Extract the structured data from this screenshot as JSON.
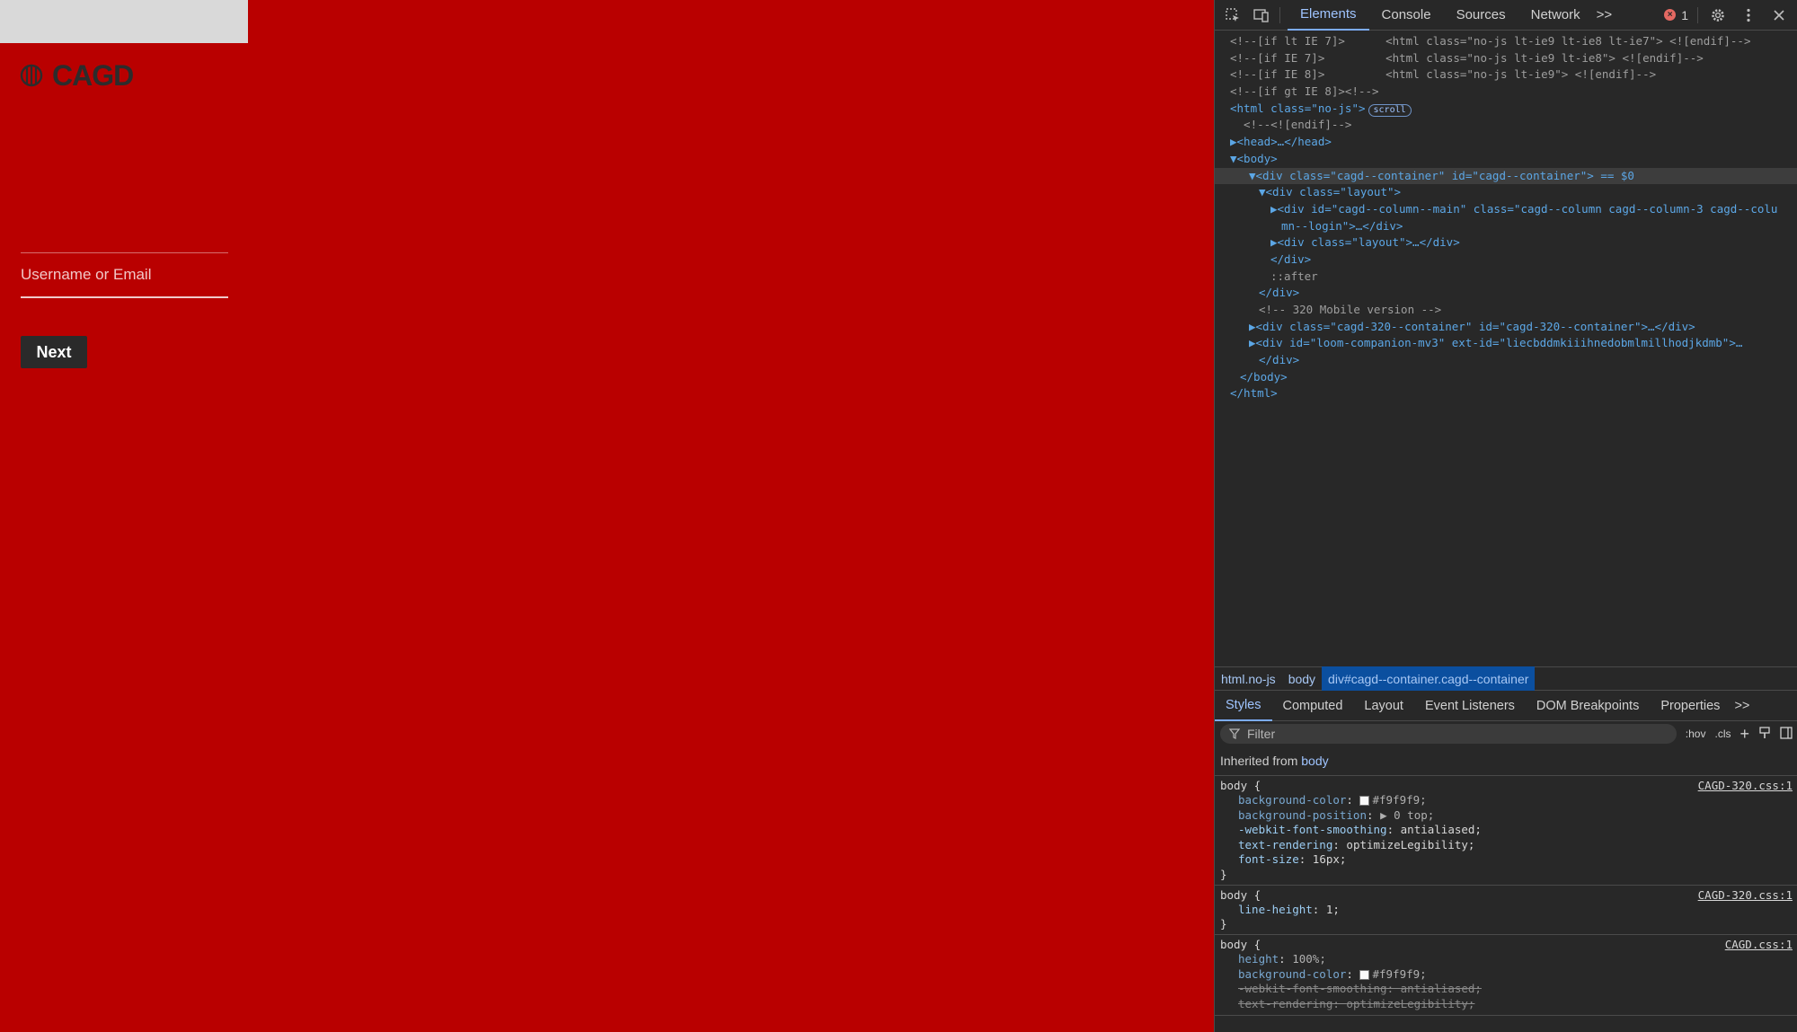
{
  "page": {
    "logo_text": "CAGD",
    "login": {
      "username_placeholder": "Username or Email",
      "next_label": "Next"
    },
    "background_color": "#b90000"
  },
  "devtools": {
    "tabs": [
      "Elements",
      "Console",
      "Sources",
      "Network"
    ],
    "more_tabs": ">>",
    "error_count": "1",
    "dom_lines": [
      "<!--[if lt IE 7]>      <html class=\"no-js lt-ie9 lt-ie8 lt-ie7\"> <![endif]-->",
      "<!--[if IE 7]>         <html class=\"no-js lt-ie9 lt-ie8\"> <![endif]-->",
      "<!--[if IE 8]>         <html class=\"no-js lt-ie9\"> <![endif]-->",
      "<!--[if gt IE 8]><!-->",
      "<html class=\"no-js\">",
      "  <!--<![endif]-->",
      "▶<head>…</head>",
      "▼<body>",
      "▼<div class=\"cagd--container\" id=\"cagd--container\"> == $0",
      "▼<div class=\"layout\">",
      "▶<div id=\"cagd--column--main\" class=\"cagd--column cagd--column-3 cagd--colu",
      "mn--login\">…</div>",
      "▶<div class=\"layout\">…</div>",
      "</div>",
      "::after",
      "</div>",
      "<!-- 320 Mobile version -->",
      "▶<div class=\"cagd-320--container\" id=\"cagd-320--container\">…</div>",
      "▶<div id=\"loom-companion-mv3\" ext-id=\"liecbddmkiiihnedobmlmillhodjkdmb\">…",
      "</div>",
      "</body>",
      "</html>"
    ],
    "scroll_badge": "scroll",
    "breadcrumb": [
      "html.no-js",
      "body",
      "div#cagd--container.cagd--container"
    ],
    "sub_tabs": [
      "Styles",
      "Computed",
      "Layout",
      "Event Listeners",
      "DOM Breakpoints",
      "Properties"
    ],
    "filter_placeholder": "Filter",
    "filter_hov": ":hov",
    "filter_cls": ".cls",
    "inherited_label": "Inherited from",
    "inherited_from": "body",
    "rules": [
      {
        "selector": "body {",
        "source": "CAGD-320.css:1",
        "decls": [
          {
            "name": "background-color",
            "value": "#f9f9f9;",
            "swatch": true
          },
          {
            "name": "background-position",
            "value": "▶ 0 top;"
          },
          {
            "name": "-webkit-font-smoothing",
            "value": "antialiased;"
          },
          {
            "name": "text-rendering",
            "value": "optimizeLegibility;"
          },
          {
            "name": "font-size",
            "value": "16px;"
          }
        ]
      },
      {
        "selector": "body {",
        "source": "CAGD-320.css:1",
        "decls": [
          {
            "name": "line-height",
            "value": "1;"
          }
        ]
      },
      {
        "selector": "body {",
        "source": "CAGD.css:1",
        "decls": [
          {
            "name": "height",
            "value": "100%;"
          },
          {
            "name": "background-color",
            "value": "#f9f9f9;",
            "swatch": true
          },
          {
            "name": "-webkit-font-smoothing",
            "value": "antialiased;",
            "strike": true
          },
          {
            "name": "text-rendering",
            "value": "optimizeLegibility;",
            "strike": true
          }
        ]
      }
    ],
    "close_brace": "}"
  }
}
